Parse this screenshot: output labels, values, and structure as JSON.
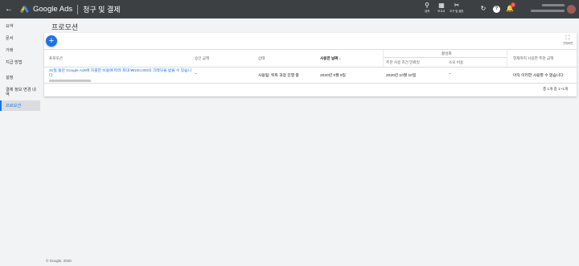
{
  "topbar": {
    "back_icon": "arrow-back",
    "product": "Google Ads",
    "section": "청구 및 결제",
    "tools": [
      {
        "icon": "search-icon",
        "glyph": "⚲",
        "label": "검색"
      },
      {
        "icon": "reports-icon",
        "glyph": "▦",
        "label": "보고서"
      },
      {
        "icon": "tools-icon",
        "glyph": "✂",
        "label": "도구 및 설정"
      }
    ],
    "refresh_glyph": "↻",
    "help_glyph": "?",
    "notification_count": "1"
  },
  "sidebar": {
    "items": [
      {
        "label": "요약"
      },
      {
        "label": "문서"
      },
      {
        "label": "거래"
      },
      {
        "label": "지급 방법"
      },
      {
        "label": "설정"
      },
      {
        "label": "결제 정보 변경 내역"
      },
      {
        "label": "프로모션"
      }
    ]
  },
  "main": {
    "title": "프로모션",
    "add_glyph": "+",
    "fullscreen_label": "전체화면",
    "table": {
      "headers": {
        "promotion": "프로모션",
        "approved_amount": "승인 금액",
        "status": "상태",
        "used_date": "사용한 날짜",
        "activation_group": "활성화",
        "activation_deadline": "추천 사용 조건 만료일",
        "spend": "소요 비용",
        "remaining": "현재까지 사용한 추천 금액"
      },
      "rows": [
        {
          "promotion": "31일 동안 Google Ads에 지출한 비용에 따라 최대 ₩100,000의 크레딧을 받을 수 있습니다",
          "approved_amount": "–",
          "status": "사용됨: 획득 과정 진행 중",
          "used_date": "2020년 9월 9일",
          "deadline": "2020년 10월 10일",
          "spend": "–",
          "remaining": "아직 이러한 사용할 수 없습니다."
        }
      ],
      "pagination": "총 1개 중 1~1개"
    }
  },
  "footer": "© Google, 2020."
}
